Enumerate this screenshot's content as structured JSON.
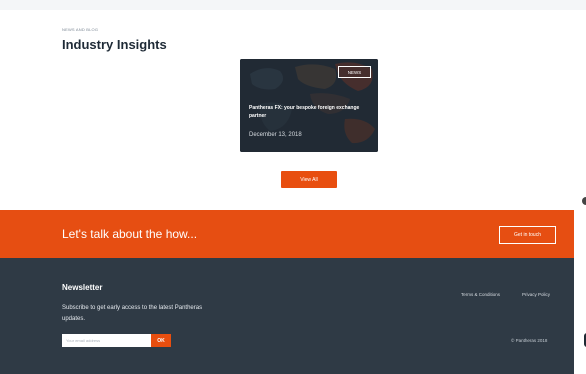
{
  "insights": {
    "eyebrow": "NEWS AND BLOG",
    "title": "Industry Insights"
  },
  "news_card": {
    "badge": "NEWS",
    "title": "Pantheras FX: your bespoke foreign exchange partner",
    "date": "December 13, 2018"
  },
  "view_all_label": "View All",
  "cta": {
    "text": "Let's talk about the how...",
    "button_label": "Get in touch"
  },
  "footer": {
    "newsletter_title": "Newsletter",
    "newsletter_desc": "Subscribe to get early access to the latest Pantheras updates.",
    "email_placeholder": "Your email address",
    "ok_label": "OK",
    "links": [
      "Terms & Conditions",
      "Privacy Policy"
    ],
    "copyright": "© Pantheras 2018"
  },
  "colors": {
    "accent": "#e84e0f",
    "footer_bg": "#2f3a45"
  }
}
